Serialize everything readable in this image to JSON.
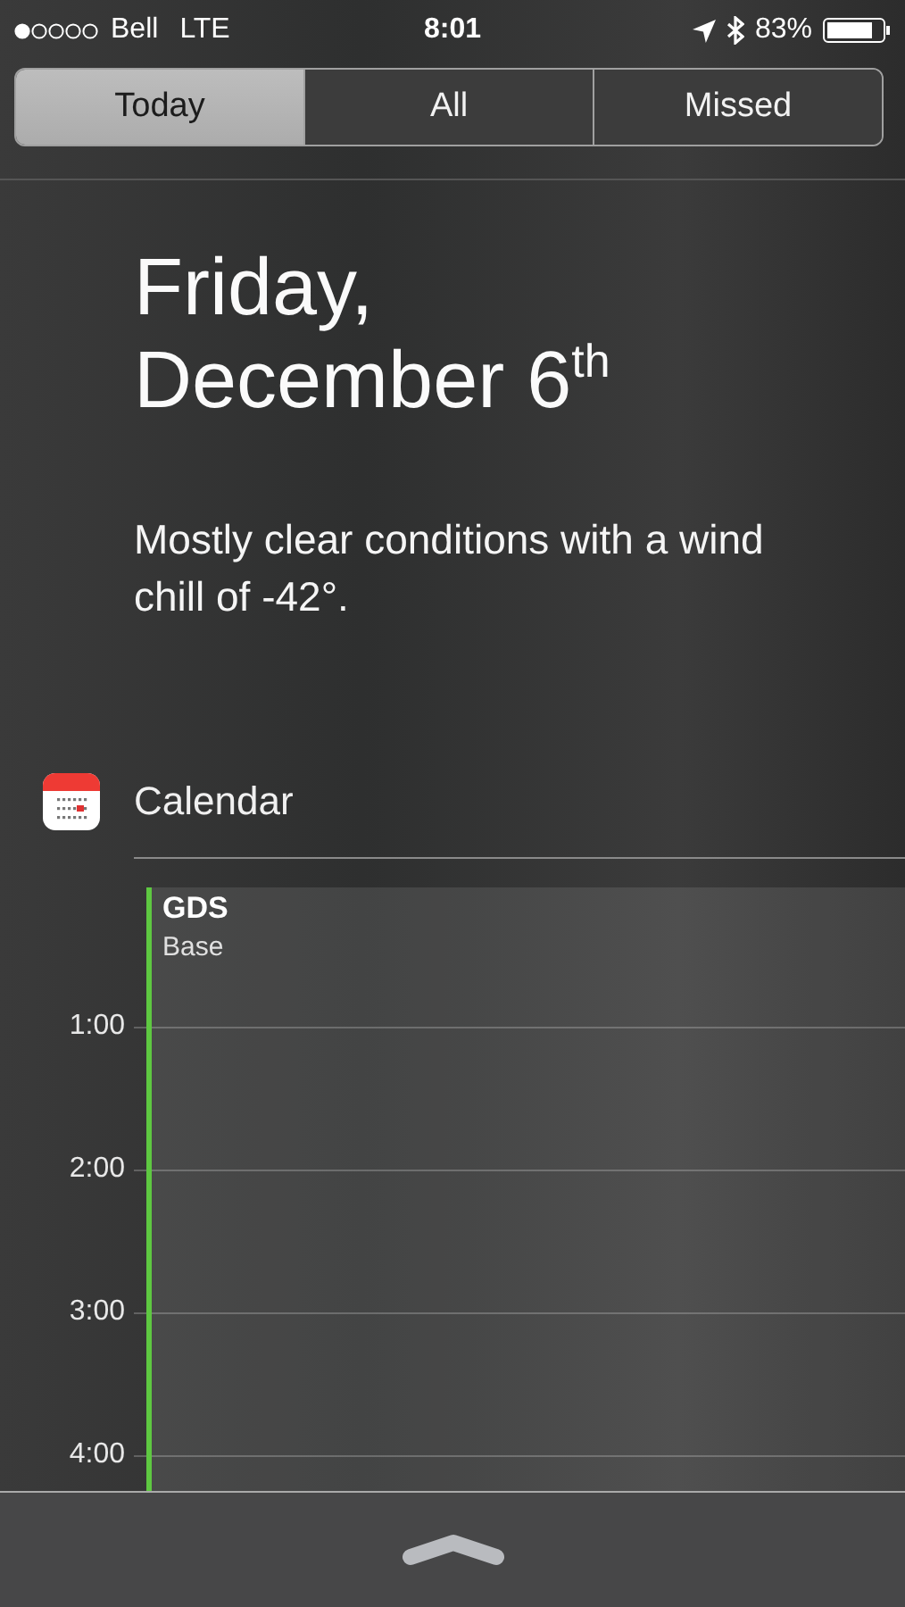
{
  "status_bar": {
    "carrier": "Bell",
    "network": "LTE",
    "time": "8:01",
    "battery": "83%"
  },
  "tabs": [
    {
      "label": "Today",
      "selected": true
    },
    {
      "label": "All",
      "selected": false
    },
    {
      "label": "Missed",
      "selected": false
    }
  ],
  "date": {
    "weekday": "Friday,",
    "day": "December 6$^{th}$"
  },
  "weather": "Mostly clear conditions with a wind chill of -42°.",
  "calendar": {
    "title": "Calendar",
    "events": [
      {
        "title": "GDS",
        "subtitle": "Base",
        "color": "#5ec841"
      }
    ],
    "hours": [
      "1:00",
      "2:00",
      "3:00",
      "4:00"
    ]
  }
}
